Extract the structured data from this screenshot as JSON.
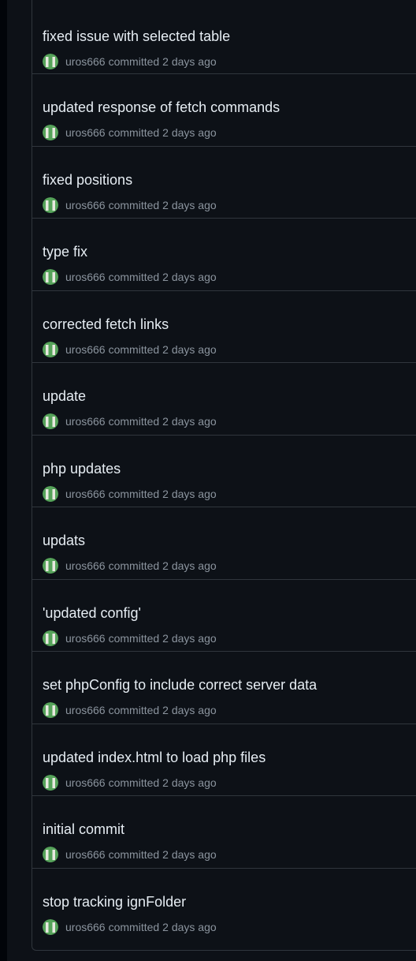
{
  "colors": {
    "background": "#0d1117",
    "border": "#30363d",
    "title": "#e6edf3",
    "meta": "#8b949e",
    "avatar_green": "#56a35a",
    "avatar_light": "#e8e8e0"
  },
  "commits": [
    {
      "title": "fixed issue with selected table",
      "author": "uros666",
      "action": "committed",
      "time": "2 days ago"
    },
    {
      "title": "updated response of fetch commands",
      "author": "uros666",
      "action": "committed",
      "time": "2 days ago"
    },
    {
      "title": "fixed positions",
      "author": "uros666",
      "action": "committed",
      "time": "2 days ago"
    },
    {
      "title": "type fix",
      "author": "uros666",
      "action": "committed",
      "time": "2 days ago"
    },
    {
      "title": "corrected fetch links",
      "author": "uros666",
      "action": "committed",
      "time": "2 days ago"
    },
    {
      "title": "update",
      "author": "uros666",
      "action": "committed",
      "time": "2 days ago"
    },
    {
      "title": "php updates",
      "author": "uros666",
      "action": "committed",
      "time": "2 days ago"
    },
    {
      "title": "updats",
      "author": "uros666",
      "action": "committed",
      "time": "2 days ago"
    },
    {
      "title": "'updated config'",
      "author": "uros666",
      "action": "committed",
      "time": "2 days ago"
    },
    {
      "title": "set phpConfig to include correct server data",
      "author": "uros666",
      "action": "committed",
      "time": "2 days ago"
    },
    {
      "title": "updated index.html to load php files",
      "author": "uros666",
      "action": "committed",
      "time": "2 days ago"
    },
    {
      "title": "initial commit",
      "author": "uros666",
      "action": "committed",
      "time": "2 days ago"
    },
    {
      "title": "stop tracking ignFolder",
      "author": "uros666",
      "action": "committed",
      "time": "2 days ago"
    }
  ]
}
